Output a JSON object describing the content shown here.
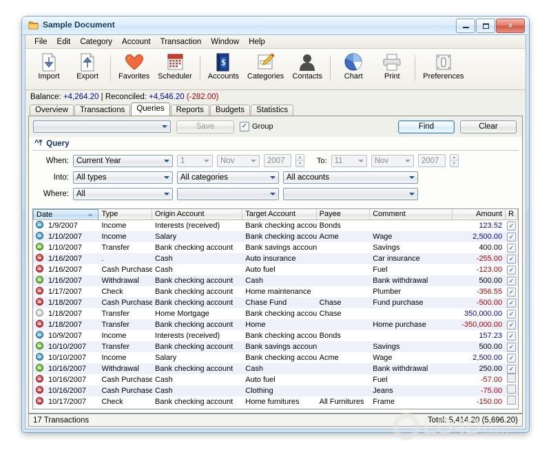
{
  "window": {
    "title": "Sample Document",
    "icon": "document-folder-icon",
    "minimize_label": "Minimize",
    "maximize_label": "Maximize",
    "close_label": "x"
  },
  "menubar": {
    "items": [
      "File",
      "Edit",
      "Category",
      "Account",
      "Transaction",
      "Window",
      "Help"
    ]
  },
  "toolbar": {
    "buttons": [
      {
        "label": "Import",
        "icon": "import-document-icon"
      },
      {
        "label": "Export",
        "icon": "export-document-icon"
      },
      {
        "label": "Favorites",
        "icon": "heart-icon"
      },
      {
        "label": "Scheduler",
        "icon": "calendar-icon"
      },
      {
        "label": "Accounts",
        "icon": "book-dollar-icon"
      },
      {
        "label": "Categories",
        "icon": "note-pencil-icon"
      },
      {
        "label": "Contacts",
        "icon": "person-icon"
      },
      {
        "label": "Chart",
        "icon": "pie-chart-icon"
      },
      {
        "label": "Print",
        "icon": "printer-icon"
      },
      {
        "label": "Preferences",
        "icon": "switch-icon"
      }
    ],
    "separators_after": [
      1,
      3,
      6,
      8
    ]
  },
  "balance": {
    "balance_label": "Balance:",
    "balance_value": "+4,264.20",
    "divider": "|",
    "reconciled_label": "Reconciled:",
    "reconciled_value": "+4,546.20",
    "difference": "(-282.00)"
  },
  "tabs": {
    "items": [
      "Overview",
      "Transactions",
      "Queries",
      "Reports",
      "Budgets",
      "Statistics"
    ],
    "active": "Queries"
  },
  "query_toolbar": {
    "saved_query_value": "",
    "save_label": "Save",
    "group_label": "Group",
    "group_checked": true,
    "group_check_glyph": "✓",
    "find_label": "Find",
    "clear_label": "Clear"
  },
  "query_section": {
    "header": "Query",
    "collapse_icon": "chevron-up-double-icon",
    "rows": {
      "when_label": "When:",
      "when_value": "Current Year",
      "from_day": "1",
      "from_month": "Nov",
      "from_year": "2007",
      "to_label": "To:",
      "to_day": "11",
      "to_month": "Nov",
      "to_year": "2007",
      "into_label": "Into:",
      "into_type": "All types",
      "into_category": "All categories",
      "into_account": "All accounts",
      "where_label": "Where:",
      "where_value": "All",
      "where_second": "",
      "where_third": ""
    }
  },
  "table": {
    "columns": [
      "Date",
      "Type",
      "Origin Account",
      "Target Account",
      "Payee",
      "Comment",
      "Amount",
      "R"
    ],
    "sorted_column": "Date",
    "sort_direction": "asc",
    "check_glyph": "✓",
    "rows": [
      {
        "status": "blue",
        "date": "1/9/2007",
        "type": "Income",
        "origin": "Interests (received)",
        "target": "Bank checking account",
        "payee": "Bonds",
        "comment": "",
        "amount": "123.52",
        "sign": "pos",
        "reconciled": true
      },
      {
        "status": "blue",
        "date": "1/10/2007",
        "type": "Income",
        "origin": "Salary",
        "target": "Bank checking account",
        "payee": "Acme",
        "comment": "Wage",
        "amount": "2,500.00",
        "sign": "pos",
        "reconciled": true
      },
      {
        "status": "green",
        "date": "1/10/2007",
        "type": "Transfer",
        "origin": "Bank checking account",
        "target": "Bank savings account",
        "payee": "",
        "comment": "Savings",
        "amount": "400.00",
        "sign": "plain",
        "reconciled": true
      },
      {
        "status": "red",
        "date": "1/16/2007",
        "type": ".",
        "origin": "Cash",
        "target": "Auto insurance",
        "payee": "",
        "comment": "Car insurance",
        "amount": "-255.00",
        "sign": "neg",
        "reconciled": true
      },
      {
        "status": "red",
        "date": "1/16/2007",
        "type": "Cash Purchase",
        "origin": "Cash",
        "target": "Auto fuel",
        "payee": "",
        "comment": "Fuel",
        "amount": "-123.00",
        "sign": "neg",
        "reconciled": true
      },
      {
        "status": "green",
        "date": "1/16/2007",
        "type": "Withdrawal",
        "origin": "Bank checking account",
        "target": "Cash",
        "payee": "",
        "comment": "Bank withdrawal",
        "amount": "500.00",
        "sign": "plain",
        "reconciled": true
      },
      {
        "status": "red",
        "date": "1/17/2007",
        "type": "Check",
        "origin": "Bank checking account",
        "target": "Home maintenance",
        "payee": "",
        "comment": "Plumber",
        "amount": "-356.55",
        "sign": "neg",
        "reconciled": true
      },
      {
        "status": "red",
        "date": "1/18/2007",
        "type": "Cash Purchase",
        "origin": "Bank checking account",
        "target": "Chase Fund",
        "payee": "Chase",
        "comment": "Fund purchase",
        "amount": "-500.00",
        "sign": "neg",
        "reconciled": true
      },
      {
        "status": "gray",
        "date": "1/18/2007",
        "type": "Transfer",
        "origin": "Home Mortgage",
        "target": "Bank checking account",
        "payee": "Chase",
        "comment": "",
        "amount": "350,000.00",
        "sign": "pos",
        "reconciled": true
      },
      {
        "status": "red",
        "date": "1/18/2007",
        "type": "Transfer",
        "origin": "Bank checking account",
        "target": "Home",
        "payee": "",
        "comment": "Home purchase",
        "amount": "-350,000.00",
        "sign": "neg",
        "reconciled": true
      },
      {
        "status": "blue",
        "date": "10/9/2007",
        "type": "Income",
        "origin": "Interests (received)",
        "target": "Bank checking account",
        "payee": "Bonds",
        "comment": "",
        "amount": "157.23",
        "sign": "pos",
        "reconciled": true
      },
      {
        "status": "green",
        "date": "10/10/2007",
        "type": "Transfer",
        "origin": "Bank checking account",
        "target": "Bank savings account",
        "payee": "",
        "comment": "Savings",
        "amount": "500.00",
        "sign": "plain",
        "reconciled": true
      },
      {
        "status": "blue",
        "date": "10/10/2007",
        "type": "Income",
        "origin": "Salary",
        "target": "Bank checking account",
        "payee": "Acme",
        "comment": "Wage",
        "amount": "2,500.00",
        "sign": "pos",
        "reconciled": true
      },
      {
        "status": "green",
        "date": "10/16/2007",
        "type": "Withdrawal",
        "origin": "Bank checking account",
        "target": "Cash",
        "payee": "",
        "comment": "Bank withdrawal",
        "amount": "250.00",
        "sign": "plain",
        "reconciled": true
      },
      {
        "status": "red",
        "date": "10/16/2007",
        "type": "Cash Purchase",
        "origin": "Cash",
        "target": "Auto fuel",
        "payee": "",
        "comment": "Fuel",
        "amount": "-57.00",
        "sign": "neg",
        "reconciled": false
      },
      {
        "status": "red",
        "date": "10/16/2007",
        "type": "Cash Purchase",
        "origin": "Cash",
        "target": "Clothing",
        "payee": "",
        "comment": "Jeans",
        "amount": "-75.00",
        "sign": "neg",
        "reconciled": false
      },
      {
        "status": "red",
        "date": "10/17/2007",
        "type": "Check",
        "origin": "Bank checking account",
        "target": "Home furnitures",
        "payee": "All Furnitures",
        "comment": "Frame",
        "amount": "-150.00",
        "sign": "neg",
        "reconciled": false
      }
    ]
  },
  "statusbar": {
    "left": "17 Transactions",
    "right": "Total: 5,414.20 (5,696.20)"
  },
  "watermark": {
    "text": "LO4D",
    "suffix": ".com",
    "icon": "recycle-arrows-icon"
  },
  "colors": {
    "accent_blue": "#3c7fb1",
    "negative": "#aa0000",
    "positive": "#0000b4",
    "header_text": "#14346b"
  }
}
